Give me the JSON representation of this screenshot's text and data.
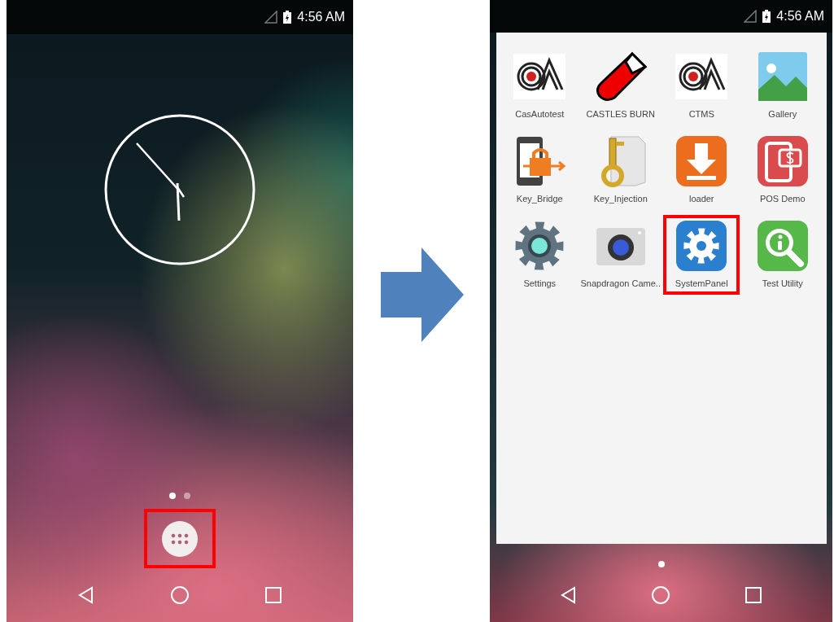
{
  "home_screen": {
    "status_bar": {
      "time": "4:56 AM"
    },
    "page_dots": [
      {
        "selected": true
      },
      {
        "selected": false
      }
    ],
    "app_drawer_button": {
      "highlighted": true
    }
  },
  "app_drawer": {
    "status_bar": {
      "time": "4:56 AM"
    },
    "apps": [
      {
        "label": "CasAutotest",
        "kind": "ca-logo",
        "highlighted": false
      },
      {
        "label": "CASTLES BURN",
        "kind": "test-tube",
        "highlighted": false
      },
      {
        "label": "CTMS",
        "kind": "ca-logo",
        "highlighted": false
      },
      {
        "label": "Gallery",
        "kind": "gallery",
        "highlighted": false
      },
      {
        "label": "Key_Bridge",
        "kind": "phone-lock",
        "highlighted": false
      },
      {
        "label": "Key_Injection",
        "kind": "key",
        "highlighted": false
      },
      {
        "label": "loader",
        "kind": "download",
        "highlighted": false
      },
      {
        "label": "POS Demo",
        "kind": "pos",
        "highlighted": false
      },
      {
        "label": "Settings",
        "kind": "settings-gear",
        "highlighted": false
      },
      {
        "label": "Snapdragon Came..",
        "kind": "camera",
        "highlighted": false
      },
      {
        "label": "SystemPanel",
        "kind": "system-gear",
        "highlighted": true
      },
      {
        "label": "Test Utility",
        "kind": "info-magnifier",
        "highlighted": false
      }
    ],
    "page_dots": [
      {
        "selected": true
      }
    ]
  }
}
